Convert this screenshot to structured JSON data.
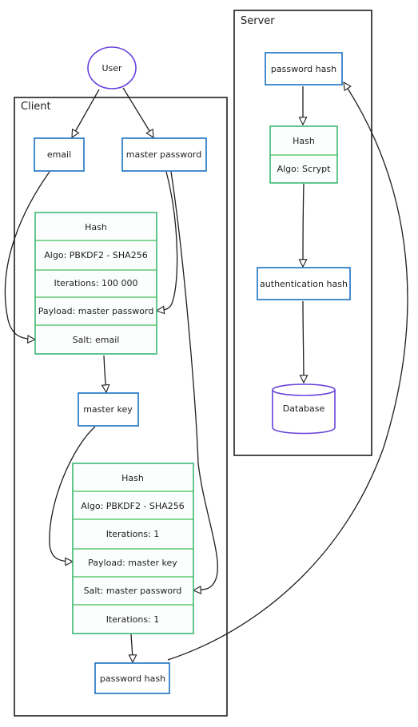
{
  "diagram": {
    "user": {
      "label": "User"
    },
    "client": {
      "title": "Client",
      "email": "email",
      "master_password": "master password",
      "hash1": {
        "rows": [
          "Hash",
          "Algo: PBKDF2 - SHA256",
          "Iterations: 100 000",
          "Payload: master password",
          "Salt: email"
        ]
      },
      "master_key": "master key",
      "hash2": {
        "rows": [
          "Hash",
          "Algo: PBKDF2 - SHA256",
          "Iterations: 1",
          "Payload: master key",
          "Salt: master password",
          "Iterations: 1"
        ]
      },
      "password_hash": "password hash"
    },
    "server": {
      "title": "Server",
      "password_hash": "password hash",
      "hash": {
        "rows": [
          "Hash",
          "Algo: Scrypt"
        ]
      },
      "authentication_hash": "authentication hash",
      "database": "Database"
    },
    "edges": [
      {
        "from": "User",
        "to": "email"
      },
      {
        "from": "User",
        "to": "master password"
      },
      {
        "from": "email",
        "to": "Salt: email"
      },
      {
        "from": "master password",
        "to": "Payload: master password"
      },
      {
        "from": "Hash (PBKDF2 100 000)",
        "to": "master key"
      },
      {
        "from": "master key",
        "to": "Payload: master key"
      },
      {
        "from": "master password",
        "to": "Salt: master password"
      },
      {
        "from": "Hash (PBKDF2 1)",
        "to": "password hash"
      },
      {
        "from": "password hash (client)",
        "to": "password hash (server)"
      },
      {
        "from": "password hash (server)",
        "to": "Hash (Scrypt)"
      },
      {
        "from": "Hash (Scrypt)",
        "to": "authentication hash"
      },
      {
        "from": "authentication hash",
        "to": "Database"
      }
    ]
  },
  "colors": {
    "stroke": "#1e1e1e",
    "blue": "#1971c2",
    "green": "#40c057",
    "purple": "#6741d9"
  }
}
